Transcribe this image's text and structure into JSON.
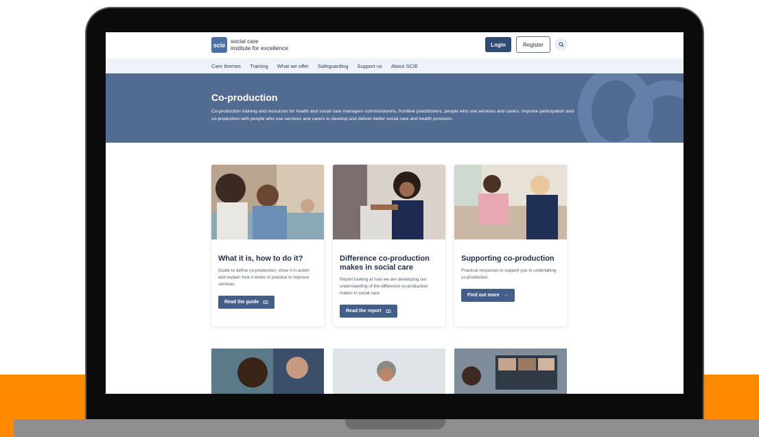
{
  "header": {
    "logo_mark": "scie",
    "logo_line1": "social care",
    "logo_line2": "institute for excellence",
    "login_label": "Login",
    "register_label": "Register"
  },
  "nav": {
    "items": [
      "Care themes",
      "Training",
      "What we offer",
      "Safeguarding",
      "Support us",
      "About SCIE"
    ]
  },
  "hero": {
    "title": "Co-production",
    "description": "Co-production training and resources for health and social care managers commissioners, frontline practitioners, people who use services and carers. Improve participation and co-production with people who use services and carers to develop and deliver better social care and health provision."
  },
  "cards": [
    {
      "title": "What it is, how to do it?",
      "description": "Guide to define co-production, show it in action and explain how it works in practice to improve services.",
      "cta": "Read the guide"
    },
    {
      "title": "Difference co-production makes in social care",
      "description": "Report looking at how we are developing our understanding of the difference co-production makes in social care.",
      "cta": "Read the report"
    },
    {
      "title": "Supporting co-production",
      "description": "Practical resources to support you in undertaking co-production.",
      "cta": "Find out more"
    }
  ],
  "colors": {
    "brand": "#4c6fa6",
    "hero": "#526b93",
    "button_dark": "#2d4b73",
    "accent_orange": "#ff8a00"
  }
}
